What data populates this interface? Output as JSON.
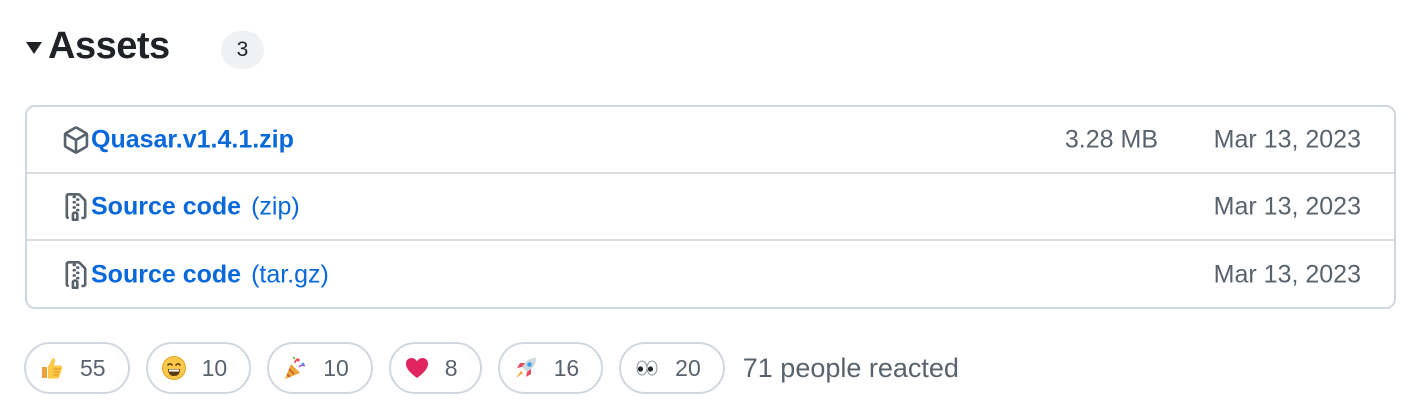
{
  "assets": {
    "title": "Assets",
    "count": "3",
    "files": [
      {
        "name": "Quasar.v1.4.1.zip",
        "suffix": "",
        "size": "3.28 MB",
        "date": "Mar 13, 2023",
        "icon": "package-icon"
      },
      {
        "name": "Source code",
        "suffix": "(zip)",
        "size": "",
        "date": "Mar 13, 2023",
        "icon": "file-zip-icon"
      },
      {
        "name": "Source code",
        "suffix": "(tar.gz)",
        "size": "",
        "date": "Mar 13, 2023",
        "icon": "file-zip-icon"
      }
    ]
  },
  "reactions": {
    "items": [
      {
        "emoji": "thumbs-up",
        "count": "55"
      },
      {
        "emoji": "laugh",
        "count": "10"
      },
      {
        "emoji": "hooray",
        "count": "10"
      },
      {
        "emoji": "heart",
        "count": "8"
      },
      {
        "emoji": "rocket",
        "count": "16"
      },
      {
        "emoji": "eyes",
        "count": "20"
      }
    ],
    "summary": "71 people reacted"
  },
  "colors": {
    "link": "#0969da",
    "muted": "#59636e",
    "border": "#d0d7de",
    "text": "#1f2328"
  }
}
